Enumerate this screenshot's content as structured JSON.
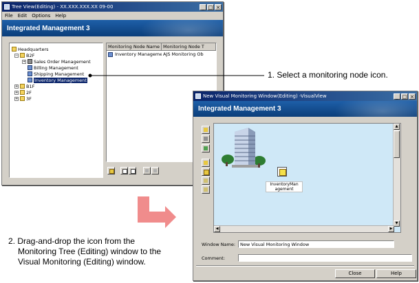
{
  "tree_window": {
    "title": "Tree View(Editing) - XX.XXX.XXX.XX 09-00",
    "menu": [
      "File",
      "Edit",
      "Options",
      "Help"
    ],
    "banner": "Integrated Management 3",
    "tree": [
      {
        "label": "Headquarters",
        "icon": "building-folder-icon"
      },
      {
        "label": "B2F",
        "icon": "folder-icon",
        "expander": "−"
      },
      {
        "label": "Sales Order Management",
        "icon": "server-icon",
        "expander": "+"
      },
      {
        "label": "Billing Management",
        "icon": "network-node-icon"
      },
      {
        "label": "Shipping Management",
        "icon": "network-node-icon"
      },
      {
        "label": "Inventory Management",
        "icon": "network-node-icon",
        "selected": true
      },
      {
        "label": "B1F",
        "icon": "folder-icon",
        "expander": "+"
      },
      {
        "label": "2F",
        "icon": "folder-icon",
        "expander": "+"
      },
      {
        "label": "3F",
        "icon": "folder-icon",
        "expander": "+"
      }
    ],
    "list_columns": [
      "Monitoring Node Name",
      "Monitoring Node T"
    ],
    "list_rows": [
      {
        "name": "Inventory Management",
        "type": "AJS Monitoring Ob"
      }
    ]
  },
  "visual_window": {
    "title": "New Visual Monitoring Window(Editing) -VisualView",
    "banner": "Integrated Management 3",
    "node_label": "InventoryMan agement",
    "window_name_label": "Window Name:",
    "window_name_value": "New Visual Monitoring Window",
    "comment_label": "Comment:",
    "comment_value": "",
    "close_label": "Close",
    "help_label": "Help"
  },
  "annotations": {
    "step1": "1. Select a monitoring node icon.",
    "step2_lines": [
      "2. Drag-and-drop the icon from the",
      "Monitoring Tree (Editing) window to the",
      "Visual Monitoring (Editing) window."
    ]
  },
  "colors": {
    "banner": "#0b3e7a",
    "canvas_bg": "#cfe8f7",
    "drag_arrow": "#f08c8c",
    "selection": "#0a246a"
  }
}
